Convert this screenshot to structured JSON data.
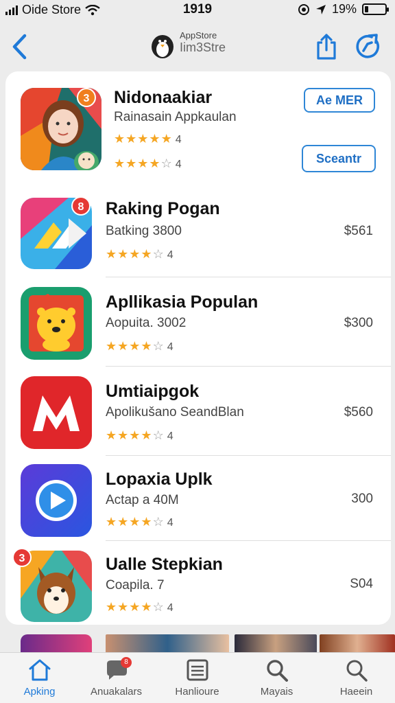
{
  "status_bar": {
    "carrier": "Oide Store",
    "time": "1919",
    "battery": "19%",
    "battery_level": 0.19
  },
  "nav": {
    "title_small": "AppStore",
    "title": "Iim3Stre"
  },
  "featured": {
    "name": "Nidonaakiar",
    "subtitle": "Rainasain Appkaulan",
    "badge": "3",
    "rating_count_1": "4",
    "rating_count_2": "4",
    "rating_1": 4.5,
    "rating_2": 3.5,
    "button_primary": "Ae MER",
    "button_secondary": "Sceantr"
  },
  "apps": [
    {
      "name": "Raking Pogan",
      "subtitle": "Batking 3800",
      "price": "$561",
      "rating": 4,
      "rating_count": "4",
      "badge": "8",
      "badge_color": "#e53935",
      "icon": "share-arrow-icon"
    },
    {
      "name": "Apllikasia Populan",
      "subtitle": "Aopuita. 3002",
      "price": "$300",
      "rating": 4,
      "rating_count": "4",
      "icon": "lion-icon"
    },
    {
      "name": "Umtiaipgok",
      "subtitle": "Apolikušano SeandBlan",
      "price": "$560",
      "rating": 4,
      "rating_count": "4",
      "icon": "m-logo-icon"
    },
    {
      "name": "Lopaxia Uplk",
      "subtitle": "Actap a 40M",
      "price": "300",
      "rating": 4,
      "rating_count": "4",
      "icon": "play-icon"
    },
    {
      "name": "Ualle Stepkian",
      "subtitle": "Coapila. 7",
      "price": "S04",
      "rating": 4,
      "rating_count": "4",
      "badge": "3",
      "badge_color": "#e53935",
      "icon": "fox-icon"
    }
  ],
  "tabs": [
    {
      "label": "Apking",
      "icon": "home-icon",
      "active": true
    },
    {
      "label": "Anuakalars",
      "icon": "chat-icon",
      "badge": "8"
    },
    {
      "label": "Hanlioure",
      "icon": "list-icon"
    },
    {
      "label": "Mayais",
      "icon": "search-icon"
    },
    {
      "label": "Haeein",
      "icon": "search-icon"
    }
  ],
  "colors": {
    "accent": "#1f7ad8",
    "star": "#f5a623",
    "badge_orange": "#f07f1e",
    "badge_red": "#e53935"
  }
}
